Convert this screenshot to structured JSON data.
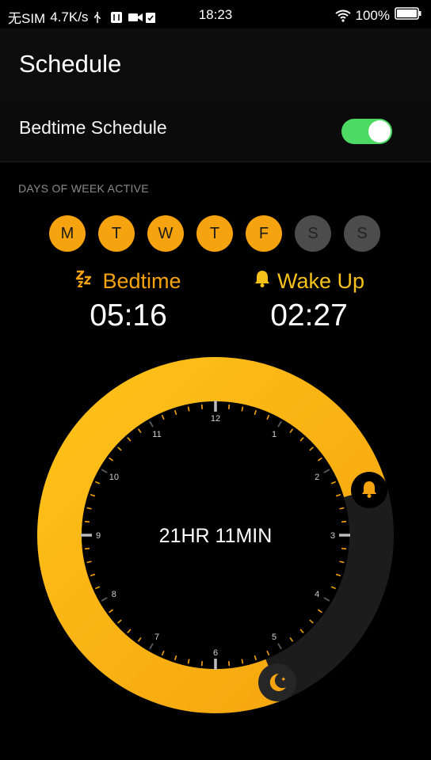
{
  "status": {
    "carrier": "无SIM",
    "speed": "4.7K/s",
    "time": "18:23",
    "battery": "100%"
  },
  "header": {
    "title": "Schedule"
  },
  "bedtime_schedule": {
    "label": "Bedtime Schedule",
    "enabled": true
  },
  "days": {
    "label": "DAYS OF WEEK ACTIVE",
    "items": [
      {
        "label": "M",
        "active": true
      },
      {
        "label": "T",
        "active": true
      },
      {
        "label": "W",
        "active": true
      },
      {
        "label": "T",
        "active": true
      },
      {
        "label": "F",
        "active": true
      },
      {
        "label": "S",
        "active": false
      },
      {
        "label": "S",
        "active": false
      }
    ]
  },
  "bedtime": {
    "label": "Bedtime",
    "time": "05:16",
    "icon": "zzz-icon"
  },
  "wakeup": {
    "label": "Wake Up",
    "time": "02:27",
    "icon": "bell-icon"
  },
  "dial": {
    "duration": "21HR 11MIN",
    "hour_labels": [
      "12",
      "1",
      "2",
      "3",
      "4",
      "5",
      "6",
      "7",
      "8",
      "9",
      "10",
      "11"
    ],
    "arc_color": "#f5a30e",
    "track_color": "#1c1c1c"
  },
  "colors": {
    "accent": "#f5a30e",
    "toggle_on": "#4cd964"
  }
}
